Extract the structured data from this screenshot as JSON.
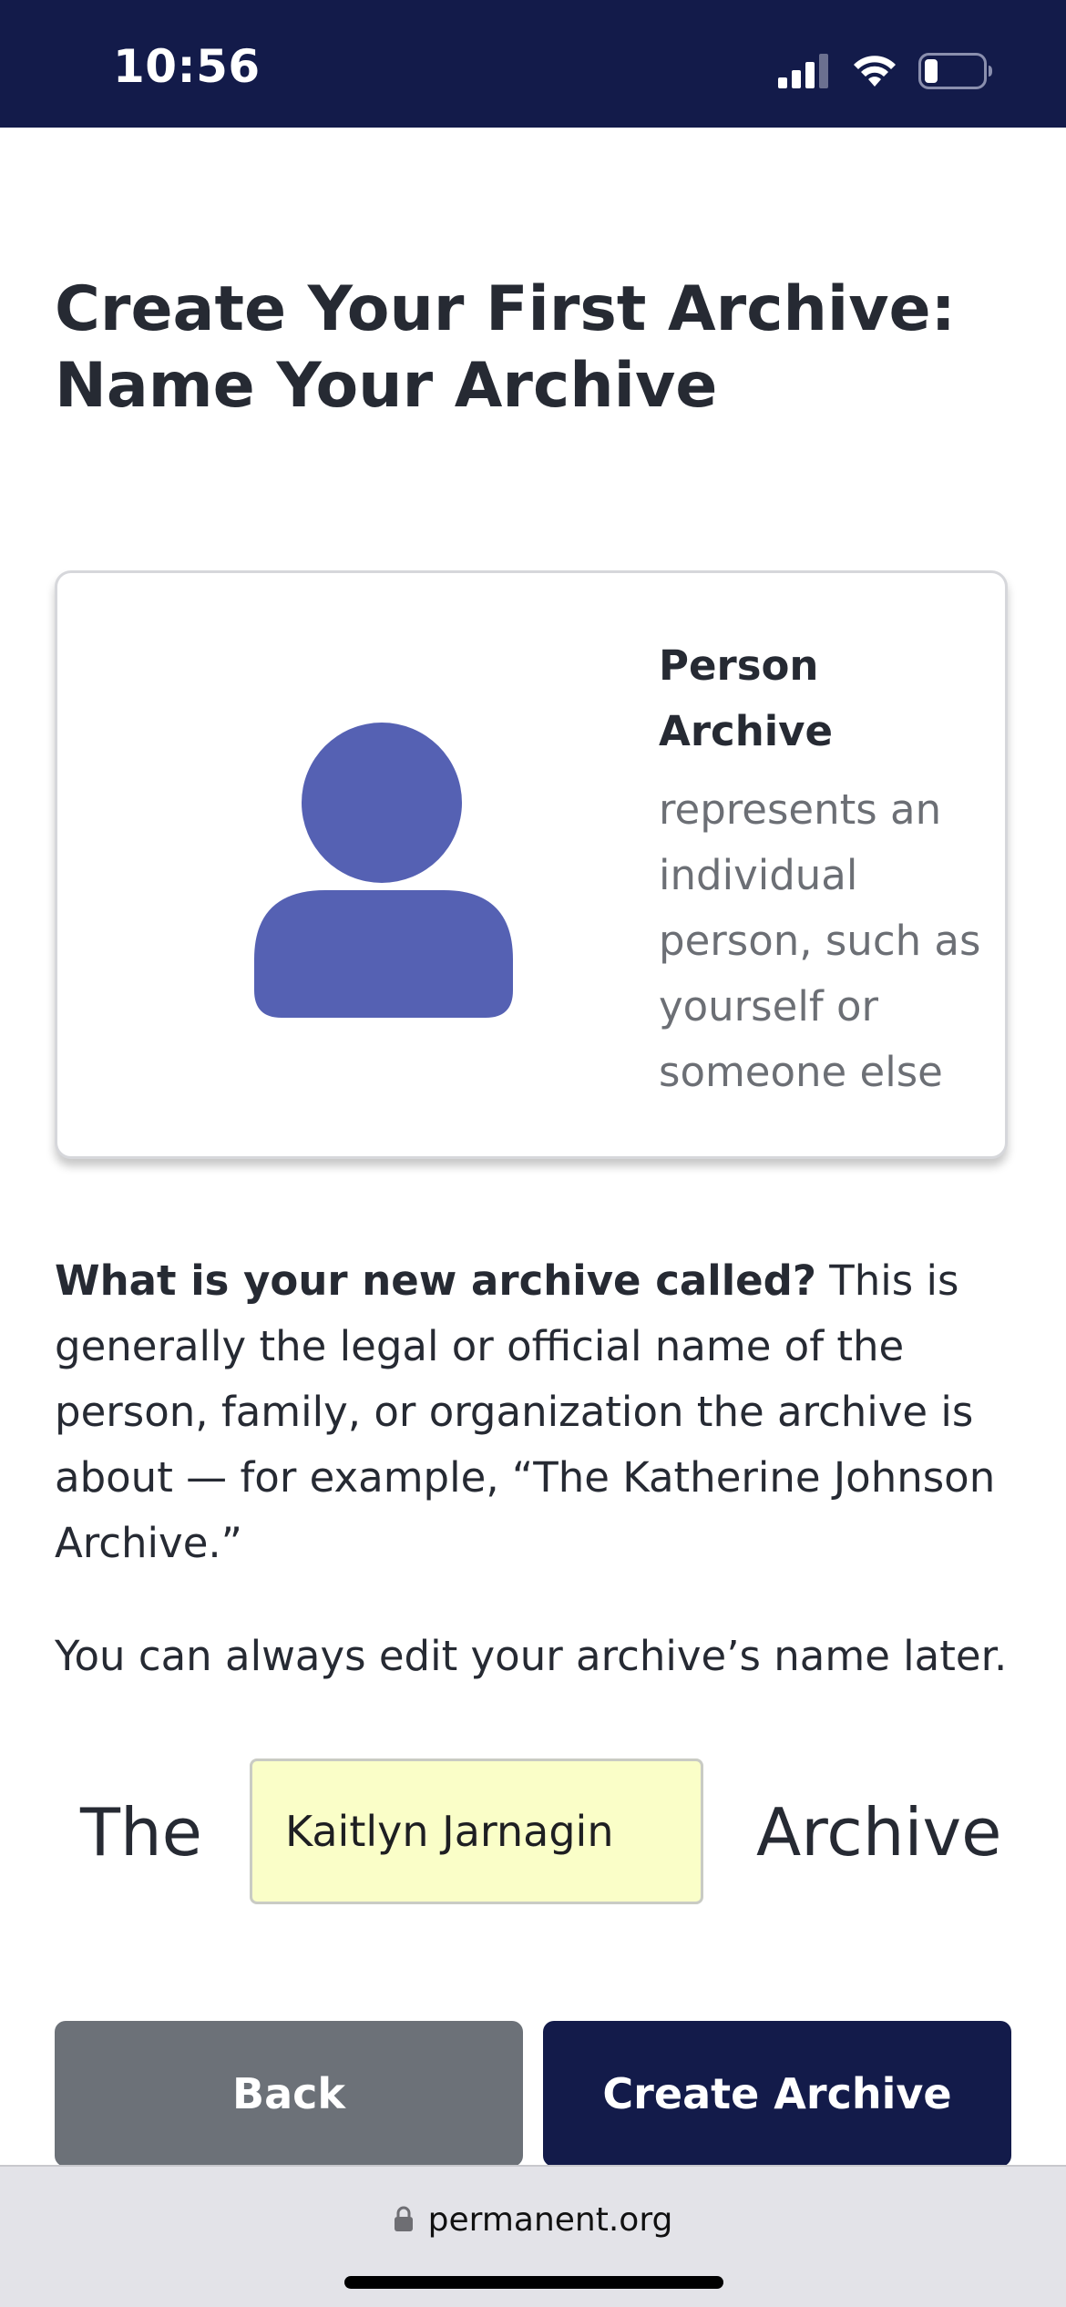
{
  "status_bar": {
    "time": "10:56",
    "icons": [
      "signal-icon",
      "wifi-icon",
      "battery-icon"
    ],
    "background": "#131b4a"
  },
  "page": {
    "title": "Create Your First Archive: Name Your Archive"
  },
  "card": {
    "icon": "person-icon",
    "icon_color": "#5561b3",
    "type_label": "Person Archive",
    "description": "represents an individual person, such as yourself or someone else"
  },
  "prompt": {
    "question": "What is your new archive called?",
    "body": " This is generally the legal or official name of the person, family, or organization the archive is about — for example, “The Katherine Johnson Archive.”",
    "edit_note": "You can always edit your archive’s name later."
  },
  "name_field": {
    "prefix": "The",
    "value": "Kaitlyn Jarnagin",
    "suffix": "Archive"
  },
  "buttons": {
    "back": "Back",
    "create": "Create Archive"
  },
  "browser": {
    "url": "permanent.org",
    "lock_icon": "lock-icon"
  }
}
